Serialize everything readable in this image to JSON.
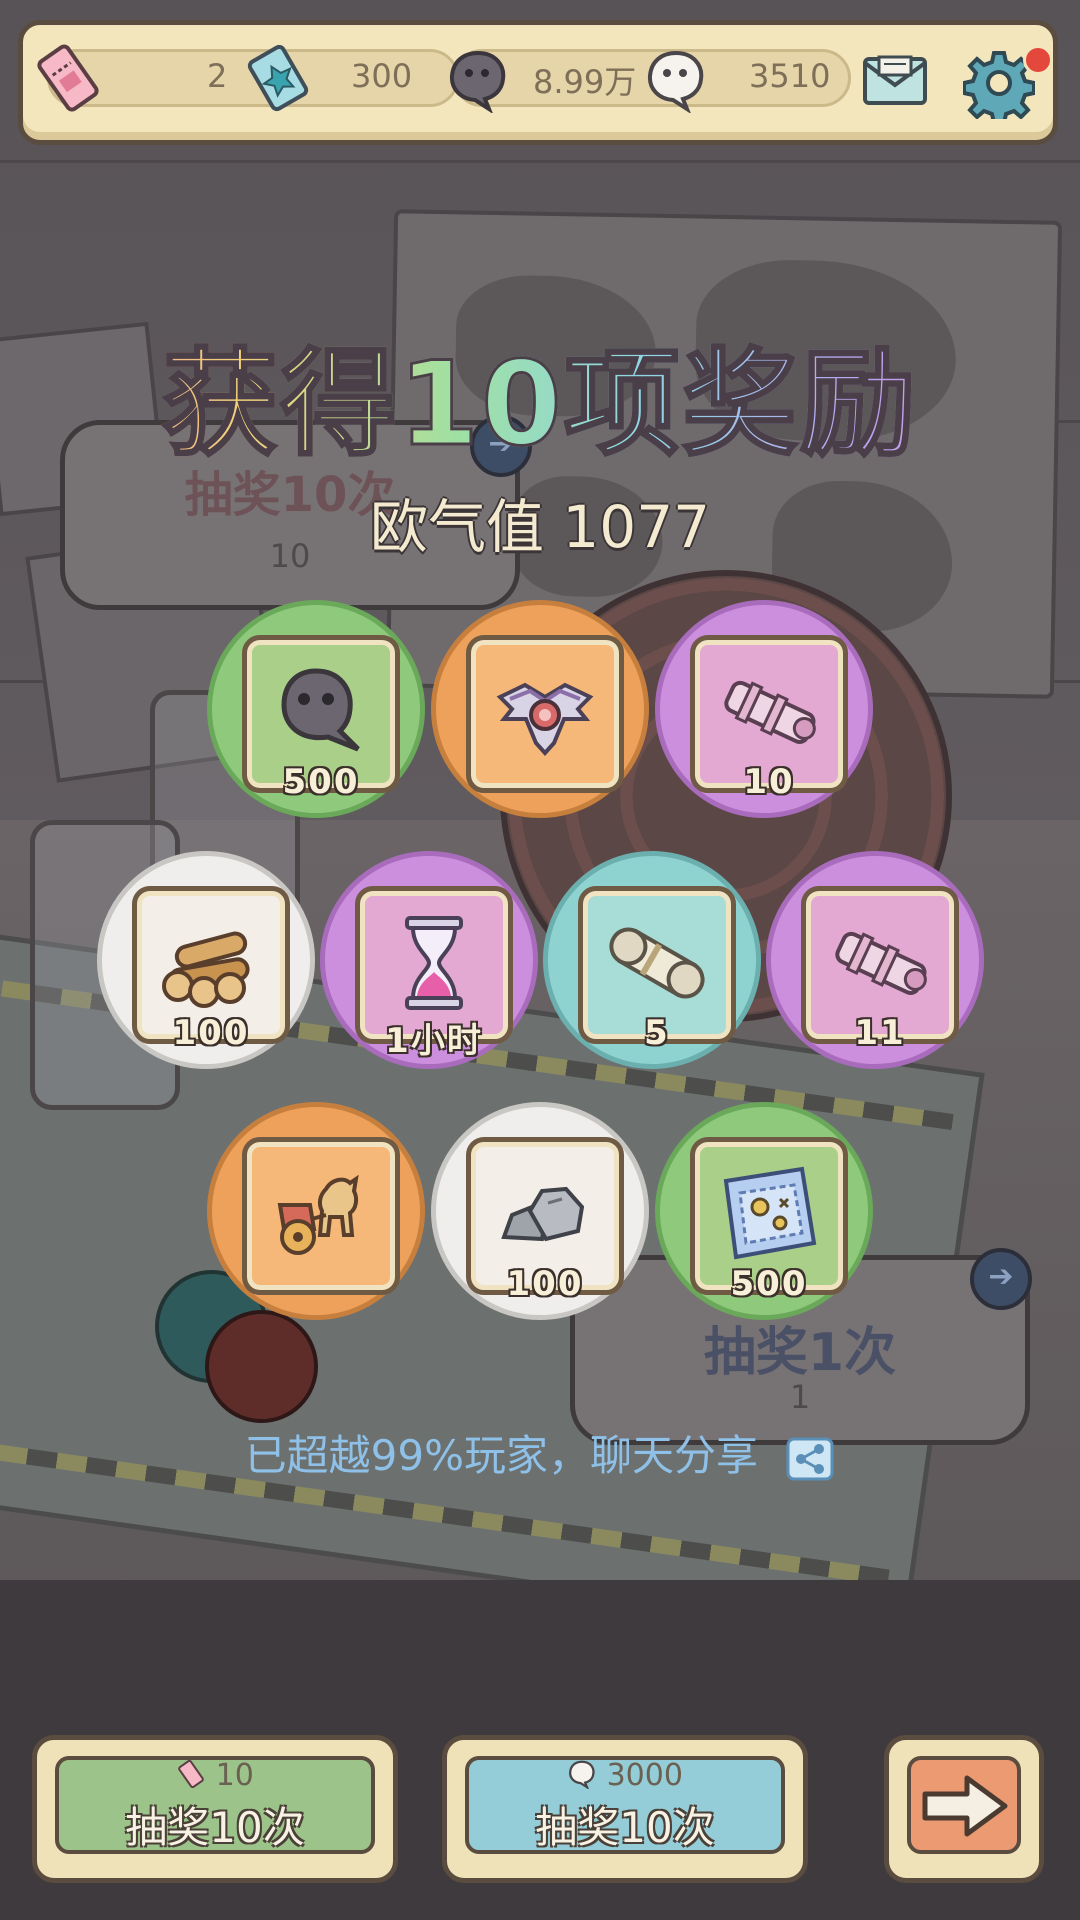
{
  "resources": {
    "ticket_count": "2",
    "gem_count": "300",
    "dark_bubble_count": "8.99万",
    "light_bubble_count": "3510"
  },
  "header": {
    "title": "获得10项奖励",
    "luck_value": "欧气值 1077"
  },
  "background_panels": {
    "draw10_label": "抽奖10次",
    "draw10_cost": "10",
    "draw1_label": "抽奖1次",
    "draw1_cost": "1"
  },
  "rewards": [
    {
      "item": "speech-bubble-currency",
      "quantity": "500",
      "rarity": "green"
    },
    {
      "item": "armored-emblem",
      "quantity": "",
      "rarity": "orange"
    },
    {
      "item": "cannon-pipe",
      "quantity": "10",
      "rarity": "purple"
    },
    {
      "item": "wood-logs",
      "quantity": "100",
      "rarity": "white"
    },
    {
      "item": "hourglass",
      "quantity": "1小时",
      "rarity": "purple"
    },
    {
      "item": "scroll",
      "quantity": "5",
      "rarity": "teal"
    },
    {
      "item": "cannon-pipe",
      "quantity": "11",
      "rarity": "purple"
    },
    {
      "item": "chariot",
      "quantity": "",
      "rarity": "orange"
    },
    {
      "item": "stones",
      "quantity": "100",
      "rarity": "white"
    },
    {
      "item": "treasure-map",
      "quantity": "500",
      "rarity": "green"
    }
  ],
  "share": {
    "text": "已超越99%玩家，聊天分享"
  },
  "buttons": {
    "ticket_draw": {
      "cost": "10",
      "label": "抽奖10次"
    },
    "bubble_draw": {
      "cost": "3000",
      "label": "抽奖10次"
    }
  },
  "colors": {
    "green": "#8fc97c",
    "orange": "#eda15a",
    "purple": "#cc8fde",
    "teal": "#8fd3d1",
    "white": "#efeeec"
  }
}
